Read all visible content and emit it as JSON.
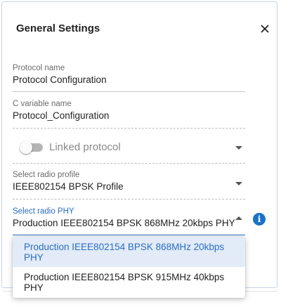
{
  "dialog": {
    "title": "General Settings"
  },
  "fields": {
    "protocol_name": {
      "label": "Protocol name",
      "value": "Protocol Configuration"
    },
    "c_variable_name": {
      "label": "C variable name",
      "value": "Protocol_Configuration"
    },
    "linked_protocol": {
      "label": "Linked protocol",
      "enabled": false
    },
    "radio_profile": {
      "label": "Select radio profile",
      "value": "IEEE802154 BPSK Profile"
    },
    "radio_phy": {
      "label": "Select radio PHY",
      "value": "Production IEEE802154 BPSK 868MHz 20kbps PHY"
    }
  },
  "phy_menu": {
    "options": [
      {
        "label": "Production IEEE802154 BPSK 868MHz 20kbps PHY",
        "selected": true
      },
      {
        "label": "Production IEEE802154 BPSK 915MHz 40kbps PHY",
        "selected": false
      }
    ]
  },
  "icons": {
    "close": "close-icon",
    "info": "info-icon",
    "dropdown": "chevron-down-icon",
    "dropdown_open": "chevron-up-icon"
  },
  "colors": {
    "accent": "#2a6ec4",
    "info_button": "#1a73c8",
    "selected_option_bg": "#e2ebf7",
    "toggle_track": "#b4b4b4"
  }
}
